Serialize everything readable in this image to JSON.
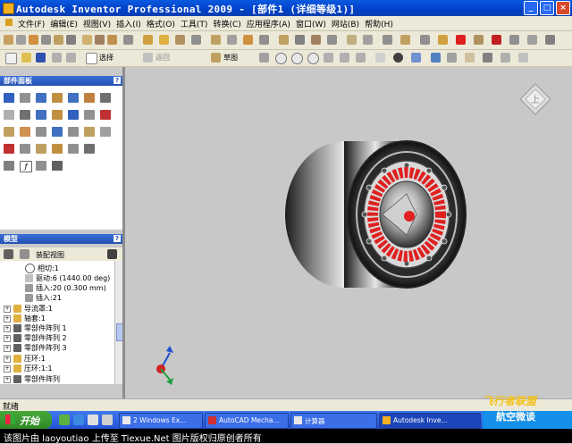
{
  "window": {
    "title": "Autodesk Inventor Professional 2009 - [部件1 (详细等级1)]",
    "min_label": "_",
    "max_label": "□",
    "close_label": "×"
  },
  "menu": [
    "文件(F)",
    "编辑(E)",
    "视图(V)",
    "插入(I)",
    "格式(O)",
    "工具(T)",
    "转换(C)",
    "应用程序(A)",
    "窗口(W)",
    "网站(B)",
    "帮助(H)"
  ],
  "toolbar": {
    "select_label": "选择",
    "return_label": "返回",
    "sketch_label": "草图"
  },
  "panel_bar": {
    "title": "部件面板",
    "help": "?"
  },
  "model_browser": {
    "title": "模型",
    "help": "?",
    "view_label": "装配视图",
    "rows": [
      "相切:1",
      "驱动:6 (1440.00 deg)",
      "插入:20 (0.300 mm)",
      "插入:21",
      "导流罩:1",
      "轴套:1",
      "零部件阵列 1",
      "零部件阵列 2",
      "零部件阵列 3",
      "压环:1",
      "压环:1:1",
      "零部件阵列"
    ]
  },
  "status": {
    "text": "就绪"
  },
  "taskbar": {
    "start": "开始",
    "tasks": [
      "2 Windows Ex...",
      "AutoCAD Mecha...",
      "计算器",
      "Autodesk Inve..."
    ]
  },
  "caption": {
    "text": "该图片由 laoyoutiao 上传至 Tiexue.Net 图片版权归原创者所有"
  },
  "watermark": {
    "top": "飞行者联盟",
    "bottom": "航空微谈"
  },
  "viewcube": {
    "face_label": "上"
  },
  "colors": {
    "titlebar": "#0a5ae0",
    "viewport": "#c8c8c8",
    "accent_red": "#e02020"
  }
}
